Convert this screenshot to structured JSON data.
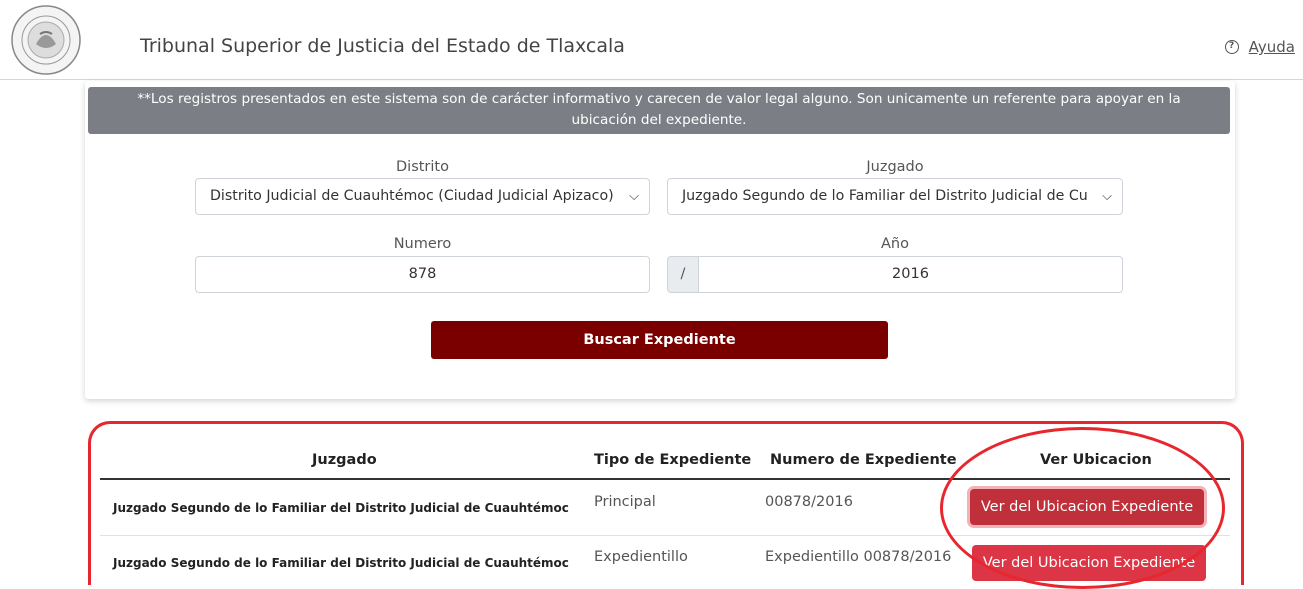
{
  "header": {
    "title": "Tribunal Superior de Justicia del Estado de Tlaxcala",
    "help_label": "Ayuda",
    "help_icon": "question-circle-icon"
  },
  "notice": {
    "text": "**Los registros presentados en este sistema son de carácter informativo y carecen de valor legal alguno. Son unicamente un referente para apoyar en la ubicación del expediente."
  },
  "form": {
    "distrito_label": "Distrito",
    "distrito_value": "Distrito Judicial de Cuauhtémoc (Ciudad Judicial Apizaco)",
    "juzgado_label": "Juzgado",
    "juzgado_value": "Juzgado Segundo de lo Familiar del Distrito Judicial de Cu",
    "numero_label": "Numero",
    "numero_value": "878",
    "anio_label": "Año",
    "anio_prefix": "/",
    "anio_value": "2016",
    "search_label": "Buscar Expediente"
  },
  "table": {
    "headers": [
      "Juzgado",
      "Tipo de Expediente",
      "Numero de Expediente",
      "Ver Ubicacion"
    ],
    "rows": [
      {
        "juzgado": "Juzgado Segundo de lo Familiar del Distrito Judicial de Cuauhtémoc",
        "tipo": "Principal",
        "numero": "00878/2016",
        "button": "Ver del Ubicacion Expediente"
      },
      {
        "juzgado": "Juzgado Segundo de lo Familiar del Distrito Judicial de Cuauhtémoc",
        "tipo": "Expedientillo",
        "numero": "Expedientillo 00878/2016",
        "button": "Ver del Ubicacion Expediente"
      }
    ]
  },
  "colors": {
    "search_button": "#7a0000",
    "notice_bg": "#7b7f85",
    "row_button": "#dc3545",
    "annotation": "#e8262e"
  }
}
